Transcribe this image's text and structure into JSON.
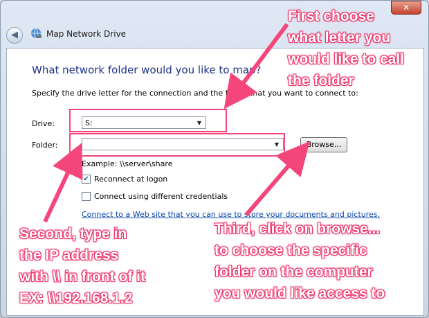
{
  "window": {
    "title": "Map Network Drive",
    "close_label": "✕"
  },
  "dialog": {
    "heading": "What network folder would you like to map?",
    "description": "Specify the drive letter for the connection and the folder that you want to connect to:",
    "drive_label": "Drive:",
    "drive_value": "S:",
    "folder_label": "Folder:",
    "folder_value": "",
    "browse_label": "Browse...",
    "example": "Example: \\\\server\\share",
    "reconnect_label": "Reconnect at logon",
    "reconnect_checked": true,
    "credentials_label": "Connect using different credentials",
    "credentials_checked": false,
    "link": "Connect to a Web site that you can use to store your documents and pictures."
  },
  "annotations": {
    "first": [
      "First choose",
      "what letter you",
      "would like to call",
      "the folder"
    ],
    "second": [
      "Second, type in",
      "the IP address",
      "with \\\\ in front of it",
      "EX: \\\\192.168.1.2"
    ],
    "third": [
      "Third, click on browse...",
      "to choose the specific",
      "folder on the computer",
      "you would like access to"
    ],
    "color": "#f4467b"
  }
}
